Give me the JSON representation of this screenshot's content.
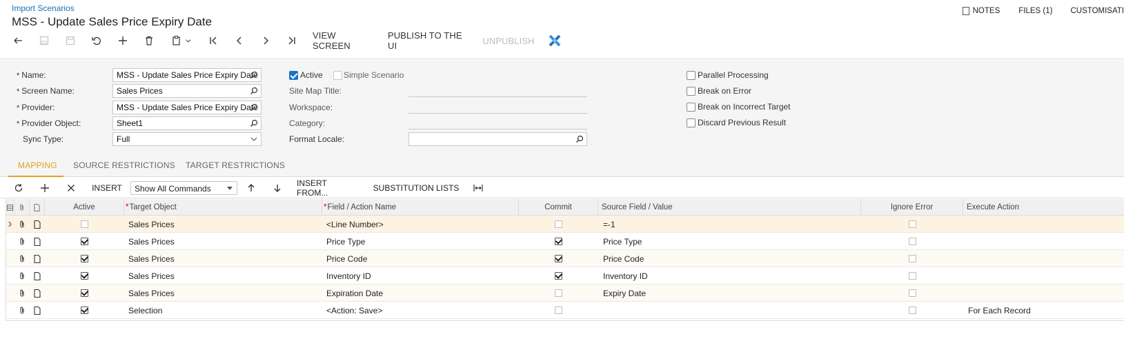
{
  "header": {
    "breadcrumb": "Import Scenarios",
    "title": "MSS - Update Sales Price Expiry Date",
    "notes_label": "NOTES",
    "files_label": "FILES (1)",
    "customisation_label": "CUSTOMISATI"
  },
  "toolbar": {
    "view_screen": "VIEW SCREEN",
    "publish": "PUBLISH TO THE UI",
    "unpublish": "UNPUBLISH"
  },
  "form": {
    "name_label": "Name:",
    "name_value": "MSS - Update Sales Price Expiry Date",
    "screen_name_label": "Screen Name:",
    "screen_name_value": "Sales Prices",
    "provider_label": "Provider:",
    "provider_value": "MSS - Update Sales Price Expiry Date",
    "provider_object_label": "Provider Object:",
    "provider_object_value": "Sheet1",
    "sync_type_label": "Sync Type:",
    "sync_type_value": "Full",
    "active_label": "Active",
    "active_checked": true,
    "simple_scenario_label": "Simple Scenario",
    "site_map_title_label": "Site Map Title:",
    "workspace_label": "Workspace:",
    "category_label": "Category:",
    "format_locale_label": "Format Locale:",
    "parallel_processing_label": "Parallel Processing",
    "break_on_error_label": "Break on Error",
    "break_on_incorrect_target_label": "Break on Incorrect Target",
    "discard_previous_result_label": "Discard Previous Result"
  },
  "tabs": [
    {
      "label": "MAPPING",
      "active": true
    },
    {
      "label": "SOURCE RESTRICTIONS",
      "active": false
    },
    {
      "label": "TARGET RESTRICTIONS",
      "active": false
    }
  ],
  "grid_toolbar": {
    "insert": "INSERT",
    "command_filter": "Show All Commands",
    "insert_from": "INSERT FROM...",
    "substitution_lists": "SUBSTITUTION LISTS"
  },
  "grid": {
    "columns": {
      "active": "Active",
      "target_object": "Target Object",
      "field_action": "Field / Action Name",
      "commit": "Commit",
      "source_field": "Source Field / Value",
      "ignore_error": "Ignore Error",
      "execute_action": "Execute Action"
    },
    "rows": [
      {
        "active": false,
        "target": "Sales Prices",
        "field": "<Line Number>",
        "commit": false,
        "source": "=-1",
        "ignore_error": false,
        "execute": ""
      },
      {
        "active": true,
        "target": "Sales Prices",
        "field": "Price Type",
        "commit": true,
        "source": "Price Type",
        "ignore_error": false,
        "execute": ""
      },
      {
        "active": true,
        "target": "Sales Prices",
        "field": "Price Code",
        "commit": true,
        "source": "Price Code",
        "ignore_error": false,
        "execute": ""
      },
      {
        "active": true,
        "target": "Sales Prices",
        "field": "Inventory ID",
        "commit": true,
        "source": "Inventory ID",
        "ignore_error": false,
        "execute": ""
      },
      {
        "active": true,
        "target": "Sales Prices",
        "field": "Expiration Date",
        "commit": false,
        "source": "Expiry Date",
        "ignore_error": false,
        "execute": ""
      },
      {
        "active": true,
        "target": "Selection",
        "field": "<Action: Save>",
        "commit": false,
        "source": "",
        "ignore_error": false,
        "execute": "For Each Record"
      }
    ]
  },
  "colors": {
    "accent_tab": "#e0a020",
    "link": "#1a6fb5",
    "checkbox_blue": "#1a73c8"
  }
}
